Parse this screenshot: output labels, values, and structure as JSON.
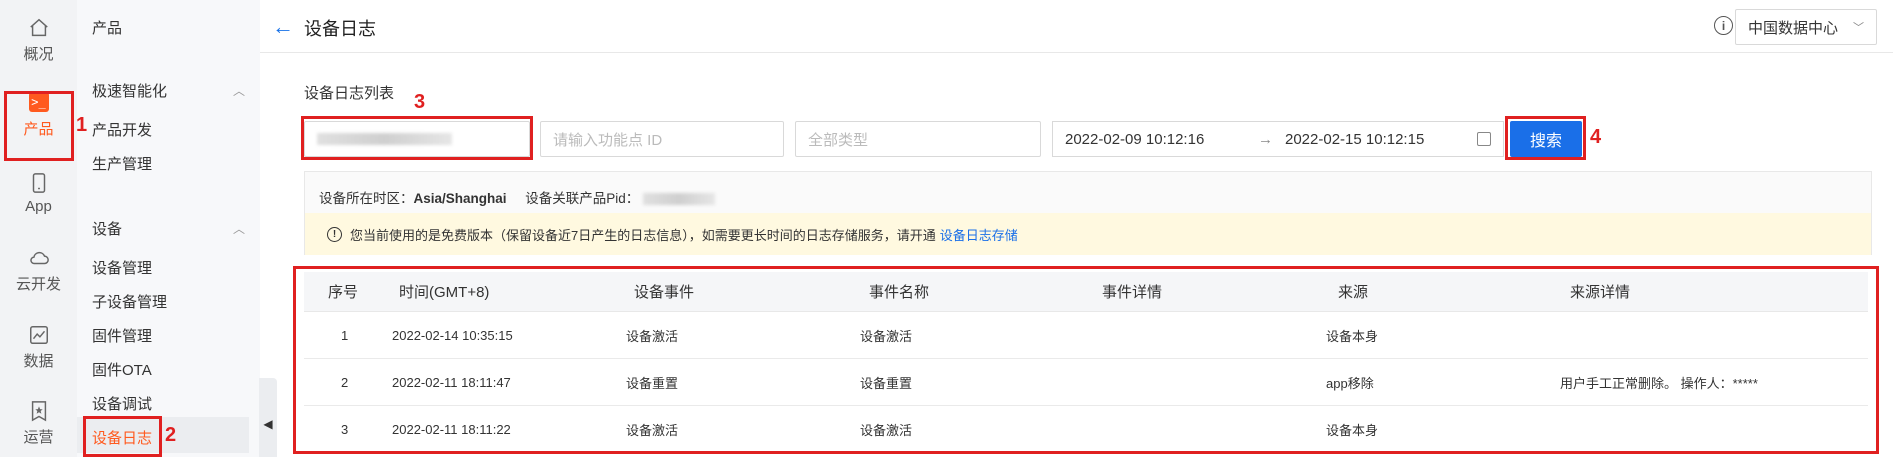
{
  "rail": {
    "items": [
      {
        "label": "概况",
        "icon": "home-icon"
      },
      {
        "label": "产品",
        "icon": "terminal-icon"
      },
      {
        "label": "App",
        "icon": "phone-icon"
      },
      {
        "label": "云开发",
        "icon": "cloud-icon"
      },
      {
        "label": "数据",
        "icon": "chart-icon"
      },
      {
        "label": "运营",
        "icon": "star-bookmark-icon"
      }
    ],
    "active_color": "#ff5a1f"
  },
  "subnav": {
    "title": "产品",
    "group1": {
      "label": "极速智能化",
      "items": [
        "产品开发",
        "生产管理"
      ]
    },
    "group2": {
      "label": "设备",
      "items": [
        "设备管理",
        "子设备管理",
        "固件管理",
        "固件OTA",
        "设备调试",
        "设备日志"
      ]
    }
  },
  "header": {
    "title": "设备日志",
    "region": "中国数据中心"
  },
  "filters": {
    "list_title": "设备日志列表",
    "func_placeholder": "请输入功能点 ID",
    "type_placeholder": "全部类型",
    "date_start": "2022-02-09  10:12:16",
    "date_end": "2022-02-15  10:12:15",
    "search_label": "搜索"
  },
  "info": {
    "tz_label": "设备所在时区：",
    "tz_value": "Asia/Shanghai",
    "pid_label": "设备关联产品Pid：",
    "notice": "您当前使用的是免费版本（保留设备近7日产生的日志信息），如需要更长时间的日志存储服务，请开通",
    "notice_link": "设备日志存储"
  },
  "annotations": [
    "1",
    "2",
    "3",
    "4"
  ],
  "table": {
    "headers": [
      "序号",
      "时间(GMT+8)",
      "设备事件",
      "事件名称",
      "事件详情",
      "来源",
      "来源详情"
    ],
    "rows": [
      [
        "1",
        "2022-02-14 10:35:15",
        "设备激活",
        "设备激活",
        "",
        "设备本身",
        ""
      ],
      [
        "2",
        "2022-02-11 18:11:47",
        "设备重置",
        "设备重置",
        "",
        "app移除",
        "用户手工正常删除。 操作人：*****"
      ],
      [
        "3",
        "2022-02-11 18:11:22",
        "设备激活",
        "设备激活",
        "",
        "设备本身",
        ""
      ]
    ]
  },
  "colors": {
    "accent": "#1a6fe8",
    "annotation": "#e02020",
    "notice_bg": "#fff9e0"
  }
}
